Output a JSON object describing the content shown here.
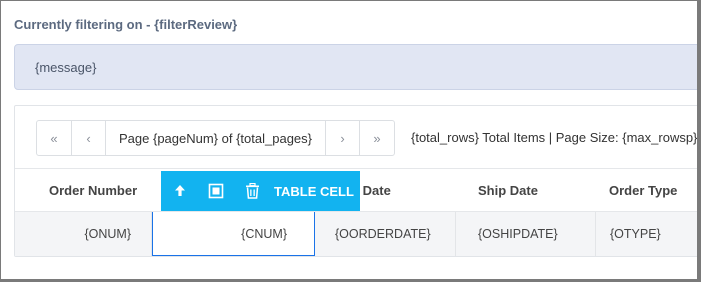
{
  "header": {
    "filter_label": "Currently filtering on - {filterReview}"
  },
  "alert": {
    "message": "{message}"
  },
  "pager": {
    "first_icon": "double-chevron-left-icon",
    "first": "«",
    "prev_icon": "chevron-left-icon",
    "prev": "‹",
    "page_label": "Page {pageNum} of {total_pages}",
    "next_icon": "chevron-right-icon",
    "next": "›",
    "last_icon": "double-chevron-right-icon",
    "last": "»",
    "info": "{total_rows} Total Items | Page Size: {max_rowsp}"
  },
  "table": {
    "columns": [
      "Order Number",
      "r Date",
      "Ship Date",
      "Order Type"
    ],
    "row": [
      "{ONUM}",
      "{CNUM}",
      "{OORDERDATE}",
      "{OSHIPDATE}",
      "{OTYPE}"
    ]
  },
  "toolbar": {
    "icons": [
      "arrow-up-icon",
      "select-parent-icon",
      "trash-icon"
    ],
    "label": "TABLE CELL",
    "color": "#12b3f0"
  }
}
